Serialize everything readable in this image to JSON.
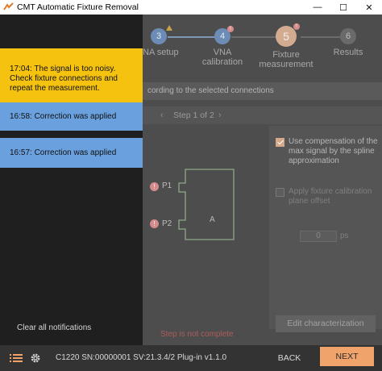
{
  "window": {
    "title": "CMT Automatic Fixture Removal",
    "icon": "cmt-logo-icon",
    "controls": {
      "minimize": "—",
      "maximize": "☐",
      "close": "✕"
    }
  },
  "stepper": {
    "steps": [
      {
        "number": "3",
        "label": "NA setup",
        "state": "done",
        "indicator": "warning-triangle"
      },
      {
        "number": "4",
        "label_line1": "VNA",
        "label_line2": "calibration",
        "state": "done",
        "badge": "!"
      },
      {
        "number": "5",
        "label_line1": "Fixture",
        "label_line2": "measurement",
        "state": "current",
        "badge": "!"
      },
      {
        "number": "6",
        "label": "Results",
        "state": "future"
      }
    ]
  },
  "info_bar": {
    "text": "cording to the selected connections"
  },
  "step_nav": {
    "prev": "‹",
    "label": "Step 1 of 2",
    "next": "›"
  },
  "diagram": {
    "ports": [
      {
        "label": "P1",
        "status": "error",
        "badge": "!"
      },
      {
        "label": "P2",
        "status": "error",
        "badge": "!"
      }
    ],
    "box_label": "A"
  },
  "options": {
    "spline": {
      "label": "Use compensation of the max signal by the spline approximation",
      "checked": true
    },
    "plane_offset": {
      "label": "Apply fixture calibration plane offset",
      "checked": false,
      "disabled": true
    },
    "offset_value": "0",
    "offset_unit": "ps",
    "edit_button": "Edit characterization"
  },
  "status": {
    "text": "Step is not complete"
  },
  "notifications": {
    "items": [
      {
        "type": "warning",
        "text": "17:04: The signal is too noisy. Check fixture connections and repeat the measurement."
      },
      {
        "type": "info",
        "text": "16:58: Correction was applied"
      },
      {
        "type": "info",
        "text": "16:57: Correction was applied"
      }
    ],
    "clear_label": "Clear all notifications"
  },
  "bottom_bar": {
    "device_info": "C1220 SN:00000001 SV:21.3.4/2 Plug-in v1.1.0",
    "back_label": "BACK",
    "next_label": "NEXT"
  },
  "colors": {
    "accent": "#f0a36b",
    "warning": "#f4c20f",
    "info": "#6aa0dd",
    "error": "#d48b8b",
    "step_done": "#6d8cb5"
  }
}
